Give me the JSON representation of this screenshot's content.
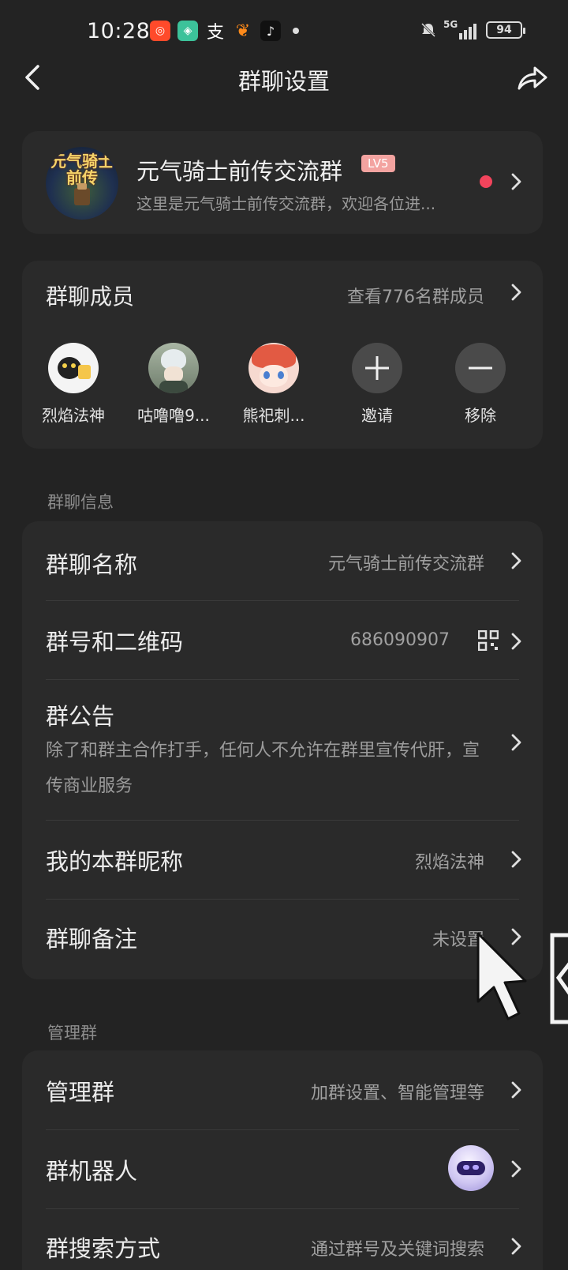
{
  "status_bar": {
    "time": "10:28",
    "icons": [
      "xiaohongshu-icon",
      "shield-app-icon",
      "alipay-icon",
      "taobao-icon",
      "tiktok-icon",
      "notification-dot-icon"
    ],
    "signal": "5G",
    "battery": "94"
  },
  "header": {
    "title": "群聊设置"
  },
  "group": {
    "avatar_text": "元气骑士 前传",
    "name": "元气骑士前传交流群",
    "level": "LV5",
    "description": "这里是元气骑士前传交流群，欢迎各位进..."
  },
  "members": {
    "title": "群聊成员",
    "view_all": "查看776名群成员",
    "list": [
      {
        "name": "烈焰法神"
      },
      {
        "name": "咕噜噜9..."
      },
      {
        "name": "熊祀刺..."
      }
    ],
    "invite_label": "邀请",
    "remove_label": "移除"
  },
  "group_info": {
    "section_label": "群聊信息",
    "group_name_title": "群聊名称",
    "group_name_value": "元气骑士前传交流群",
    "group_id_title": "群号和二维码",
    "group_id_value": "686090907",
    "notice_title": "群公告",
    "notice_text": "除了和群主合作打手，任何人不允许在群里宣传代肝，宣传商业服务",
    "nickname_title": "我的本群昵称",
    "nickname_value": "烈焰法神",
    "remark_title": "群聊备注",
    "remark_value": "未设置"
  },
  "manage": {
    "section_label": "管理群",
    "manage_title": "管理群",
    "manage_value": "加群设置、智能管理等",
    "robot_title": "群机器人",
    "search_title": "群搜索方式",
    "search_value": "通过群号及关键词搜索"
  },
  "colors": {
    "background": "#232323",
    "card": "#2a2a2a",
    "level_badge": "#f3a3a0",
    "unread_dot": "#f2445c"
  }
}
